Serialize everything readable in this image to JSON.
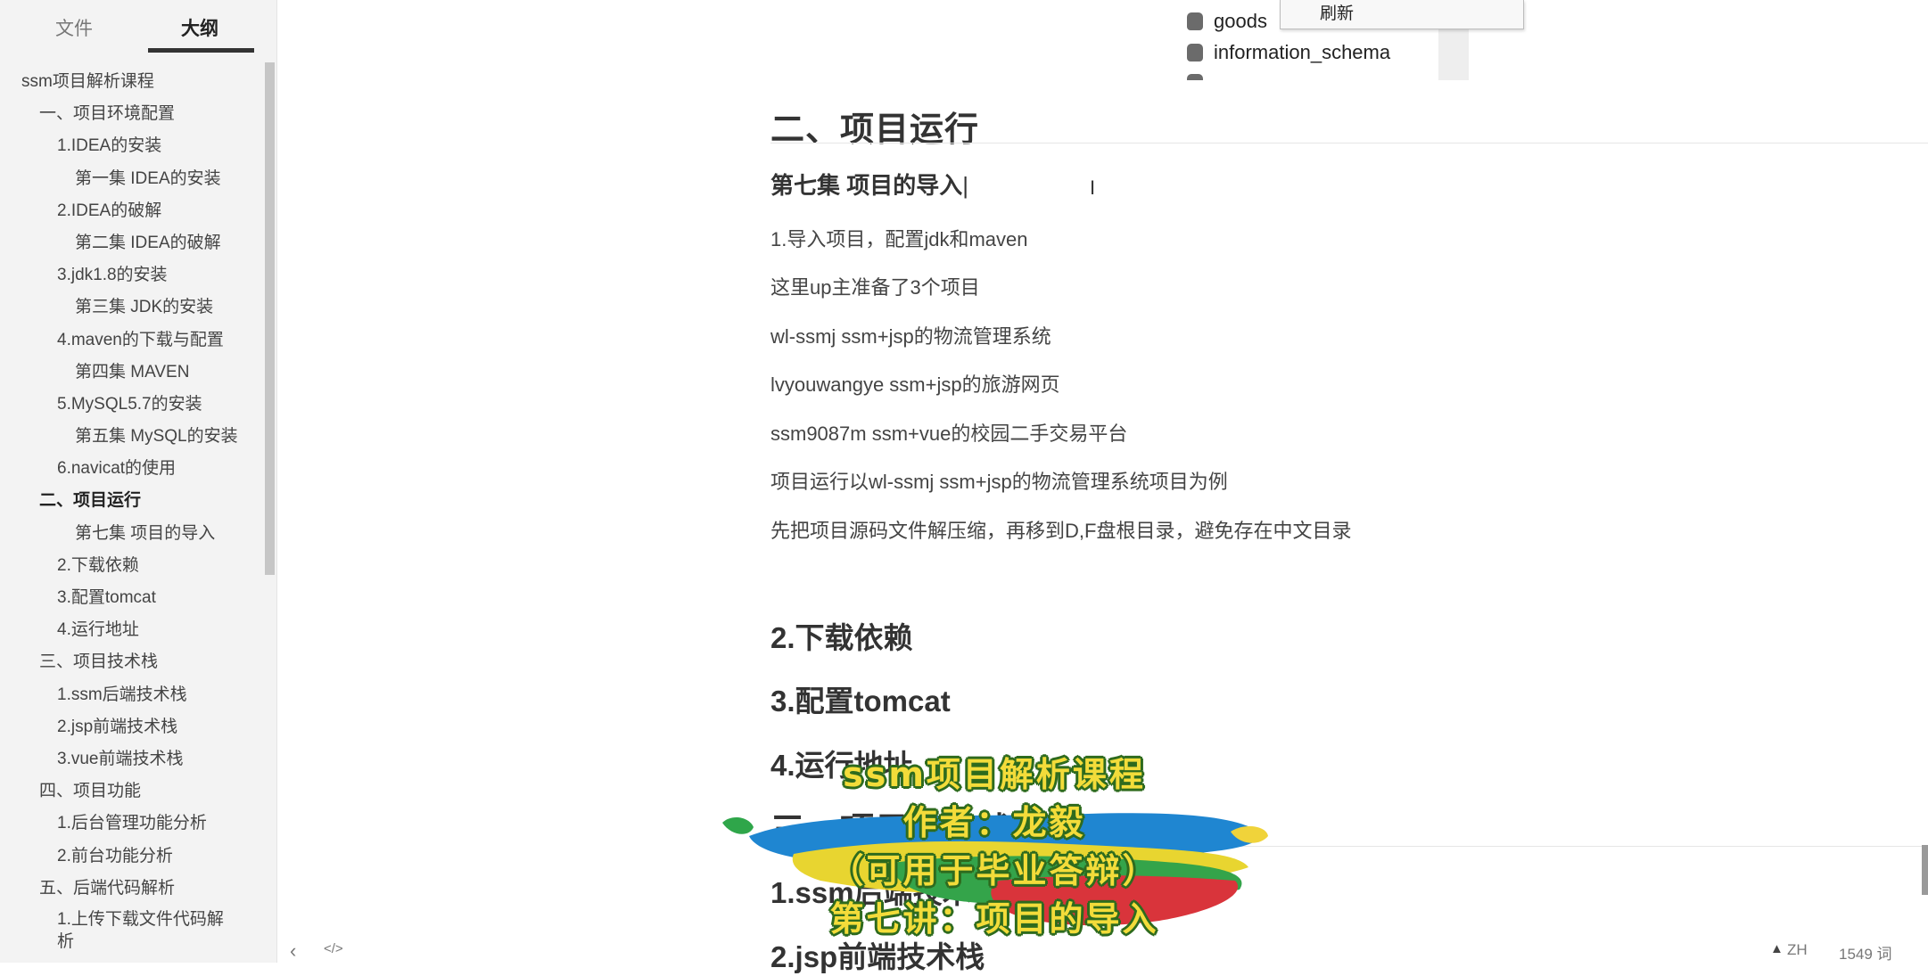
{
  "sidebar": {
    "tab_files": "文件",
    "tab_outline": "大纲",
    "items": [
      {
        "label": "ssm项目解析课程",
        "level": 0
      },
      {
        "label": "一、项目环境配置",
        "level": 1
      },
      {
        "label": "1.IDEA的安装",
        "level": 2
      },
      {
        "label": "第一集 IDEA的安装",
        "level": 3
      },
      {
        "label": "2.IDEA的破解",
        "level": 2
      },
      {
        "label": "第二集 IDEA的破解",
        "level": 3
      },
      {
        "label": "3.jdk1.8的安装",
        "level": 2
      },
      {
        "label": "第三集 JDK的安装",
        "level": 3
      },
      {
        "label": "4.maven的下载与配置",
        "level": 2
      },
      {
        "label": "第四集 MAVEN",
        "level": 3
      },
      {
        "label": "5.MySQL5.7的安装",
        "level": 2
      },
      {
        "label": "第五集 MySQL的安装",
        "level": 3
      },
      {
        "label": "6.navicat的使用",
        "level": 2
      },
      {
        "label": "二、项目运行",
        "level": 1,
        "active": true
      },
      {
        "label": "第七集 项目的导入",
        "level": 3
      },
      {
        "label": "2.下载依赖",
        "level": 2
      },
      {
        "label": "3.配置tomcat",
        "level": 2
      },
      {
        "label": "4.运行地址",
        "level": 2
      },
      {
        "label": "三、项目技术栈",
        "level": 1
      },
      {
        "label": "1.ssm后端技术栈",
        "level": 2
      },
      {
        "label": "2.jsp前端技术栈",
        "level": 2
      },
      {
        "label": "3.vue前端技术栈",
        "level": 2
      },
      {
        "label": "四、项目功能",
        "level": 1
      },
      {
        "label": "1.后台管理功能分析",
        "level": 2
      },
      {
        "label": "2.前台功能分析",
        "level": 2
      },
      {
        "label": "五、后端代码解析",
        "level": 1
      },
      {
        "label": "1.上传下载文件代码解析",
        "level": 2,
        "wrap": true
      }
    ]
  },
  "db_panel": {
    "item1": "goods",
    "item2": "information_schema",
    "context_menu_refresh": "刷新"
  },
  "document": {
    "h_run": "二、项目运行",
    "h_ep7": "第七集 项目的导入",
    "p1": "1.导入项目，配置jdk和maven",
    "p2": "这里up主准备了3个项目",
    "p3": "wl-ssmj  ssm+jsp的物流管理系统",
    "p4": "lvyouwangye  ssm+jsp的旅游网页",
    "p5": "ssm9087m  ssm+vue的校园二手交易平台",
    "p6": "项目运行以wl-ssmj  ssm+jsp的物流管理系统项目为例",
    "p7": "先把项目源码文件解压缩，再移到D,F盘根目录，避免存在中文目录",
    "h_dep": "2.下载依赖",
    "h_tomcat": "3.配置tomcat",
    "h_addr": "4.运行地址",
    "h_stack": "三、项目技术栈",
    "h_ssm": "1.ssm后端技术栈",
    "h_jsp": "2.jsp前端技术栈"
  },
  "watermark": {
    "line1": "ssm项目解析课程",
    "line2": "作者：龙毅",
    "line3": "（可用于毕业答辩）",
    "line4": "第七讲：项目的导入"
  },
  "status_bar": {
    "lang": "ZH",
    "word_count": "1549 词",
    "warning_icon": "▲",
    "back_icon": "‹",
    "code_icon": "</>"
  },
  "colors": {
    "sidebar_bg": "#f3f3f3",
    "watermark_text": "#f3dc3a",
    "watermark_outline": "#2e6b1e"
  }
}
